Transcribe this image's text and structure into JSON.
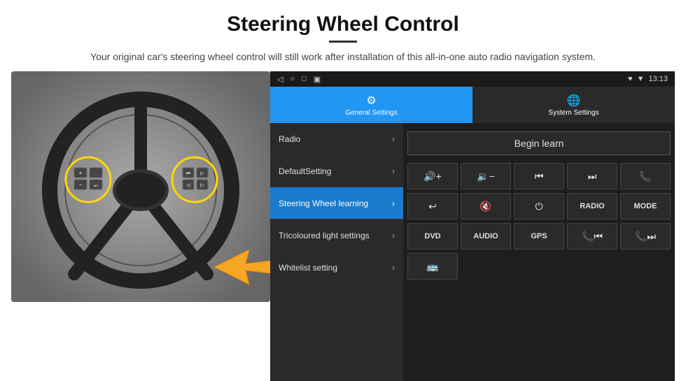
{
  "header": {
    "title": "Steering Wheel Control",
    "divider": true,
    "subtitle": "Your original car's steering wheel control will still work after installation of this all-in-one auto radio navigation system."
  },
  "statusBar": {
    "icons": [
      "◁",
      "○",
      "□",
      "▣"
    ],
    "rightIcons": "♥ ▼",
    "time": "13:13"
  },
  "tabs": [
    {
      "id": "general",
      "label": "General Settings",
      "active": true
    },
    {
      "id": "system",
      "label": "System Settings",
      "active": false
    }
  ],
  "menuItems": [
    {
      "id": "radio",
      "label": "Radio",
      "active": false
    },
    {
      "id": "default",
      "label": "DefaultSetting",
      "active": false
    },
    {
      "id": "steering",
      "label": "Steering Wheel learning",
      "active": true
    },
    {
      "id": "tricolour",
      "label": "Tricoloured light settings",
      "active": false
    },
    {
      "id": "whitelist",
      "label": "Whitelist setting",
      "active": false
    }
  ],
  "controlPanel": {
    "beginLearnLabel": "Begin learn",
    "row1": [
      {
        "icon": "🔊+",
        "label": "vol-up"
      },
      {
        "icon": "🔊−",
        "label": "vol-down"
      },
      {
        "icon": "⏮",
        "label": "prev-track"
      },
      {
        "icon": "⏭",
        "label": "next-track"
      },
      {
        "icon": "📞",
        "label": "phone"
      }
    ],
    "row2": [
      {
        "icon": "↩",
        "label": "back"
      },
      {
        "icon": "🔇",
        "label": "mute"
      },
      {
        "icon": "⏻",
        "label": "power"
      },
      {
        "text": "RADIO",
        "label": "radio-btn"
      },
      {
        "text": "MODE",
        "label": "mode-btn"
      }
    ],
    "row3": [
      {
        "text": "DVD",
        "label": "dvd-btn"
      },
      {
        "text": "AUDIO",
        "label": "audio-btn"
      },
      {
        "text": "GPS",
        "label": "gps-btn"
      },
      {
        "icon": "📞⏮",
        "label": "phone-prev"
      },
      {
        "icon": "📞⏭",
        "label": "phone-next"
      }
    ],
    "row4": [
      {
        "icon": "🚌",
        "label": "bus-icon"
      }
    ]
  }
}
